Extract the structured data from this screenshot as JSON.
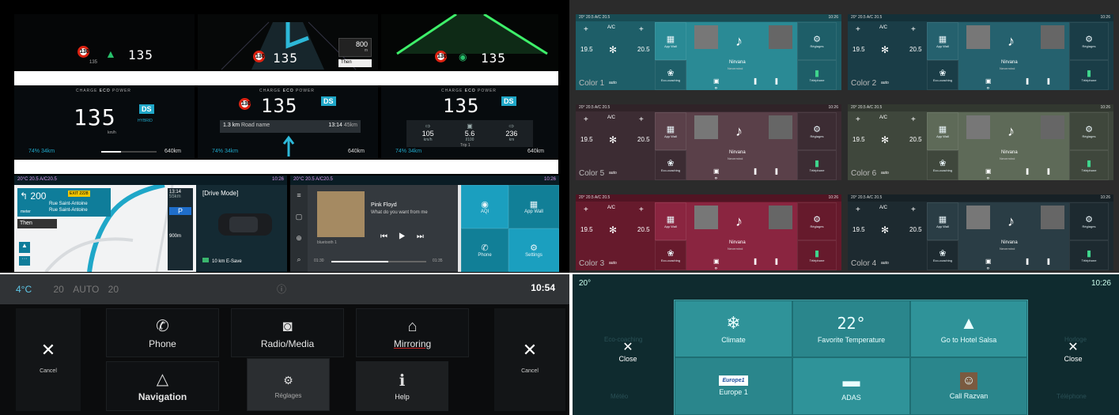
{
  "clusters": {
    "top": [
      {
        "limit": "130",
        "speed": "135",
        "sub": "135"
      },
      {
        "limit": "130",
        "speed": "135",
        "nav_distance": "800",
        "nav_unit": "m",
        "then": "Then"
      },
      {
        "limit": "130",
        "speed": "135"
      }
    ],
    "middle": [
      {
        "modes": [
          "CHARGE",
          "ECO",
          "POWER"
        ],
        "speed": "135",
        "unit": "km/h",
        "badge": "DS",
        "hybrid": "HYBRID",
        "range": "74% 34km",
        "right": "640km"
      },
      {
        "limit": "130",
        "modes": [
          "CHARGE",
          "ECO",
          "POWER"
        ],
        "speed": "135",
        "unit": "km/h",
        "badge": "DS",
        "hybrid": "HYBRID",
        "nav_dist": "1.3",
        "nav_unit": "km",
        "road": "Road name",
        "time": "13:14",
        "time_sub": "45km",
        "range": "74% 34km",
        "right": "640km"
      },
      {
        "modes": [
          "CHARGE",
          "ECO",
          "POWER"
        ],
        "speed": "135",
        "unit": "km/h",
        "badge": "DS",
        "hybrid": "HYBRID",
        "trip_values": [
          "105",
          "5.6",
          "236"
        ],
        "trip_units": [
          "km/h",
          "l/100",
          "km"
        ],
        "trip_label": "Trip 1",
        "range": "74% 34km",
        "right": "640km"
      }
    ]
  },
  "status": {
    "temp": "20°C",
    "clim": "20.5",
    "ac": "A/C20.5",
    "time": "10:26"
  },
  "nav_screen": {
    "dist": "200",
    "dist_unit": "meter",
    "exit": "EXIT 2228",
    "street1": "Rue Saint-Antoine",
    "street2": "Rue Saint-Antoine",
    "then": "Then",
    "time": "13:14",
    "time_sub": "55km",
    "range": "900m",
    "drive_mode": "[Drive Mode]",
    "esave": "10 km E-Save"
  },
  "media_screen": {
    "artist": "Pink Floyd",
    "song": "What do you want from me",
    "source": "bluetooth 1",
    "time_start": "01:30",
    "time_end": "01:35",
    "tiles": [
      "AQI",
      "App Wall",
      "Phone",
      "Settings"
    ]
  },
  "themes": [
    {
      "label": "Color 1",
      "bg": "#1e5e68",
      "accent": "#2a8a95"
    },
    {
      "label": "Color 2",
      "bg": "#1a3d47",
      "accent": "#25616e"
    },
    {
      "label": "Color 5",
      "bg": "#3c2c33",
      "accent": "#5a4049"
    },
    {
      "label": "Color 6",
      "bg": "#3f473c",
      "accent": "#5e6a58"
    },
    {
      "label": "Color 3",
      "bg": "#661a2c",
      "accent": "#8a2540"
    },
    {
      "label": "Color 4",
      "bg": "#1d2a30",
      "accent": "#2a3d45"
    }
  ],
  "theme_screen": {
    "ac": "A/C",
    "left_temp": "19.5",
    "right_temp": "20.5",
    "tile_labels": [
      "App Wall",
      "Réglages",
      "Eco-coaching",
      "Téléphone"
    ],
    "song": "Nirvana",
    "song_sub": "Nevermind",
    "auto": "auto",
    "status_left": "20°",
    "status_mid": "20.5",
    "status_ac": "A/C 20.5",
    "status_time": "10:26"
  },
  "quick_menu": {
    "status_temp": "4°C",
    "status_mid": "20",
    "status_auto": "AUTO",
    "status_right": "20",
    "time": "10:54",
    "cancel": "Cancel",
    "items": [
      {
        "label": "Phone",
        "icon": "✆"
      },
      {
        "label": "Radio/Media",
        "icon": "◙"
      },
      {
        "label": "Mirroring",
        "icon": "⌂"
      },
      {
        "label": "Navigation",
        "icon": "△"
      },
      {
        "label": "Réglages",
        "icon": "⚙"
      },
      {
        "label": "Help",
        "icon": "ℹ"
      }
    ]
  },
  "shortcut_menu": {
    "temp": "20°",
    "time": "10:26",
    "close": "Close",
    "bg_left": [
      "Eco-coaching",
      "Météo"
    ],
    "bg_right": [
      "Horloge",
      "Téléphone"
    ],
    "items": [
      {
        "label": "Climate",
        "icon": "❄"
      },
      {
        "label": "Favorite Temperature",
        "value": "22°"
      },
      {
        "label": "Go to Hotel Salsa",
        "icon": "▲"
      },
      {
        "label": "Europe 1",
        "logo": "Europe1"
      },
      {
        "label": "ADAS",
        "icon": "▬"
      },
      {
        "label": "Call Razvan",
        "icon": "☺"
      }
    ]
  }
}
